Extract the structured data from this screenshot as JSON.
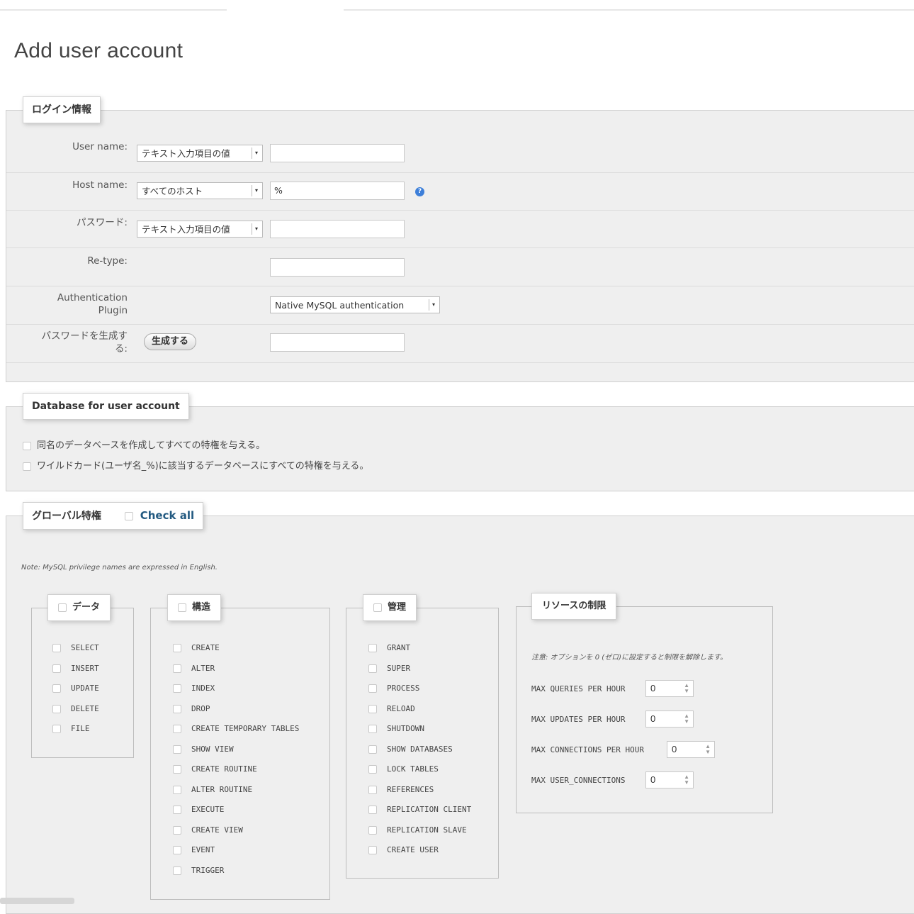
{
  "page_title": "Add user account",
  "login": {
    "legend": "ログイン情報",
    "user_name": {
      "label": "User name:",
      "select": "テキスト入力項目の値",
      "value": ""
    },
    "host_name": {
      "label": "Host name:",
      "select": "すべてのホスト",
      "value": "%"
    },
    "password": {
      "label": "パスワード:",
      "select": "テキスト入力項目の値",
      "value": ""
    },
    "retype": {
      "label": "Re-type:",
      "value": ""
    },
    "auth_plugin": {
      "label_line1": "Authentication",
      "label_line2": "Plugin",
      "select": "Native MySQL authentication"
    },
    "generate": {
      "label_line1": "パスワードを生成す",
      "label_line2": "る:",
      "button": "生成する",
      "value": ""
    }
  },
  "database": {
    "legend": "Database for user account",
    "options": [
      "同名のデータベースを作成してすべての特権を与える。",
      "ワイルドカード(ユーザ名_%)に該当するデータベースにすべての特権を与える。"
    ]
  },
  "global": {
    "legend": "グローバル特権",
    "check_all": "Check all",
    "note": "Note: MySQL privilege names are expressed in English.",
    "data": {
      "legend": "データ",
      "items": [
        "SELECT",
        "INSERT",
        "UPDATE",
        "DELETE",
        "FILE"
      ]
    },
    "structure": {
      "legend": "構造",
      "items": [
        "CREATE",
        "ALTER",
        "INDEX",
        "DROP",
        "CREATE TEMPORARY TABLES",
        "SHOW VIEW",
        "CREATE ROUTINE",
        "ALTER ROUTINE",
        "EXECUTE",
        "CREATE VIEW",
        "EVENT",
        "TRIGGER"
      ]
    },
    "admin": {
      "legend": "管理",
      "items": [
        "GRANT",
        "SUPER",
        "PROCESS",
        "RELOAD",
        "SHUTDOWN",
        "SHOW DATABASES",
        "LOCK TABLES",
        "REFERENCES",
        "REPLICATION CLIENT",
        "REPLICATION SLAVE",
        "CREATE USER"
      ]
    },
    "resources": {
      "legend": "リソースの制限",
      "note": "注意: オプションを 0 (ゼロ)に設定すると制限を解除します。",
      "rows": [
        {
          "label": "MAX QUERIES PER HOUR",
          "value": "0"
        },
        {
          "label": "MAX UPDATES PER HOUR",
          "value": "0"
        },
        {
          "label": "MAX CONNECTIONS PER HOUR",
          "value": "0"
        },
        {
          "label": "MAX USER_CONNECTIONS",
          "value": "0"
        }
      ]
    }
  },
  "icons": {
    "help": "help-icon",
    "spinner": "spinner-icon",
    "dropdown": "chevron-down-icon"
  }
}
